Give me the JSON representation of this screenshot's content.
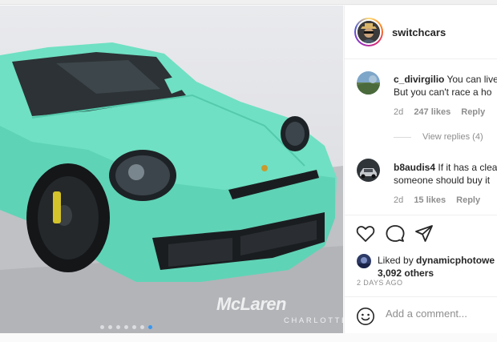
{
  "post": {
    "username": "switchcars",
    "watermark": "McLaren",
    "watermark_sub": "CHARLOTTE",
    "carousel_count": 7,
    "carousel_active": 7
  },
  "comments": [
    {
      "user": "c_divirgilio",
      "line1": "You can live",
      "line2": "But you can't race a ho",
      "age": "2d",
      "likes": "247 likes",
      "reply": "Reply"
    },
    {
      "user": "b8audis4",
      "line1": "If it has a clea",
      "line2": "someone should buy it",
      "age": "2d",
      "likes": "15 likes",
      "reply": "Reply"
    }
  ],
  "view_replies": "View replies (4)",
  "likes": {
    "liked_by_prefix": "Liked by",
    "liked_by_user": "dynamicphotowe",
    "others": "3,092 others"
  },
  "time_ago": "2 DAYS AGO",
  "add_comment": {
    "placeholder": "Add a comment..."
  },
  "icons": {
    "like": "heart-icon",
    "comment": "speech-bubble-icon",
    "share": "paper-plane-icon",
    "emoji": "smiley-icon"
  },
  "colors": {
    "car_body": "#6fe0c3",
    "accent_blue": "#3897f0",
    "muted_text": "#8e8e8e"
  }
}
